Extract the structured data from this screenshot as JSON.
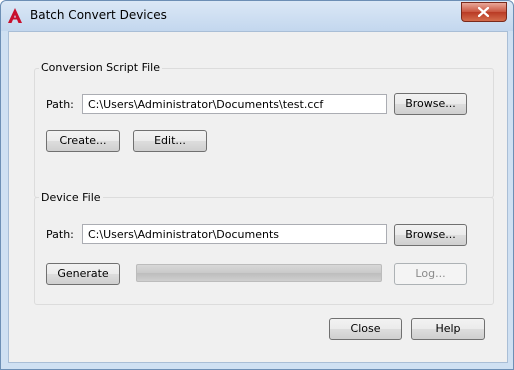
{
  "window": {
    "title": "Batch Convert Devices",
    "app_icon": "autocad-a-icon",
    "close_icon": "close-x-icon",
    "accent_close": "#c9553f"
  },
  "script_group": {
    "title": "Conversion Script File",
    "path_label": "Path:",
    "path_value": "C:\\Users\\Administrator\\Documents\\test.ccf",
    "browse_label": "Browse...",
    "create_label": "Create...",
    "edit_label": "Edit..."
  },
  "device_group": {
    "title": "Device File",
    "path_label": "Path:",
    "path_value": "C:\\Users\\Administrator\\Documents",
    "browse_label": "Browse...",
    "generate_label": "Generate",
    "progress": 0,
    "log_label": "Log..."
  },
  "footer": {
    "close_label": "Close",
    "help_label": "Help"
  }
}
